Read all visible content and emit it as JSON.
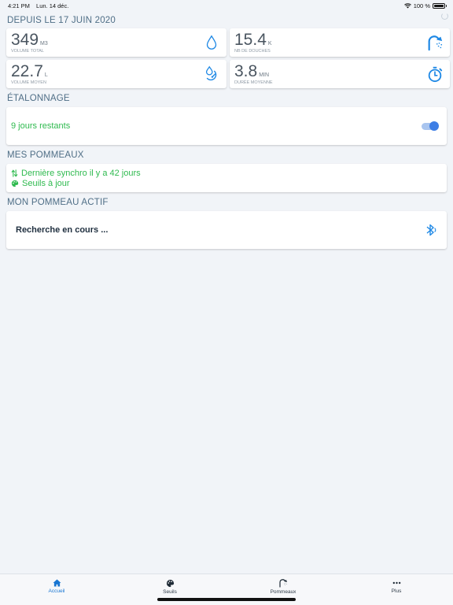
{
  "status_bar": {
    "time": "4:21 PM",
    "date": "Lun. 14 déc.",
    "battery_text": "100 %"
  },
  "stats": {
    "title": "DEPUIS LE 17 JUIN 2020",
    "items": [
      {
        "value": "349",
        "unit": "M3",
        "label": "VOLUME TOTAL",
        "icon": "water-drop-icon"
      },
      {
        "value": "15.4",
        "unit": "K",
        "label": "NB DE DOUCHES",
        "icon": "shower-head-icon"
      },
      {
        "value": "22.7",
        "unit": "L",
        "label": "VOLUME MOYEN",
        "icon": "drop-gauge-icon"
      },
      {
        "value": "3.8",
        "unit": "MIN",
        "label": "DURÉE MOYENNE",
        "icon": "stopwatch-icon"
      }
    ]
  },
  "calibration": {
    "title": "ÉTALONNAGE",
    "text": "9 jours restants",
    "toggle_on": true
  },
  "pommeaux": {
    "title": "MES POMMEAUX",
    "sync_text": "Dernière synchro il y a 42 jours",
    "thresholds_text": "Seuils à jour"
  },
  "active": {
    "title": "MON POMMEAU ACTIF",
    "text": "Recherche en cours ...",
    "icon": "bluetooth-icon"
  },
  "tabs": [
    {
      "label": "Accueil",
      "icon": "home-icon",
      "active": true
    },
    {
      "label": "Seuils",
      "icon": "palette-icon",
      "active": false
    },
    {
      "label": "Pommeaux",
      "icon": "shower-head-icon",
      "active": false
    },
    {
      "label": "Plus",
      "icon": "more-icon",
      "active": false
    }
  ],
  "colors": {
    "accent_blue": "#1976d2",
    "success_green": "#2fba4f",
    "section_title": "#4f6e86",
    "background": "#f1f4f8"
  }
}
